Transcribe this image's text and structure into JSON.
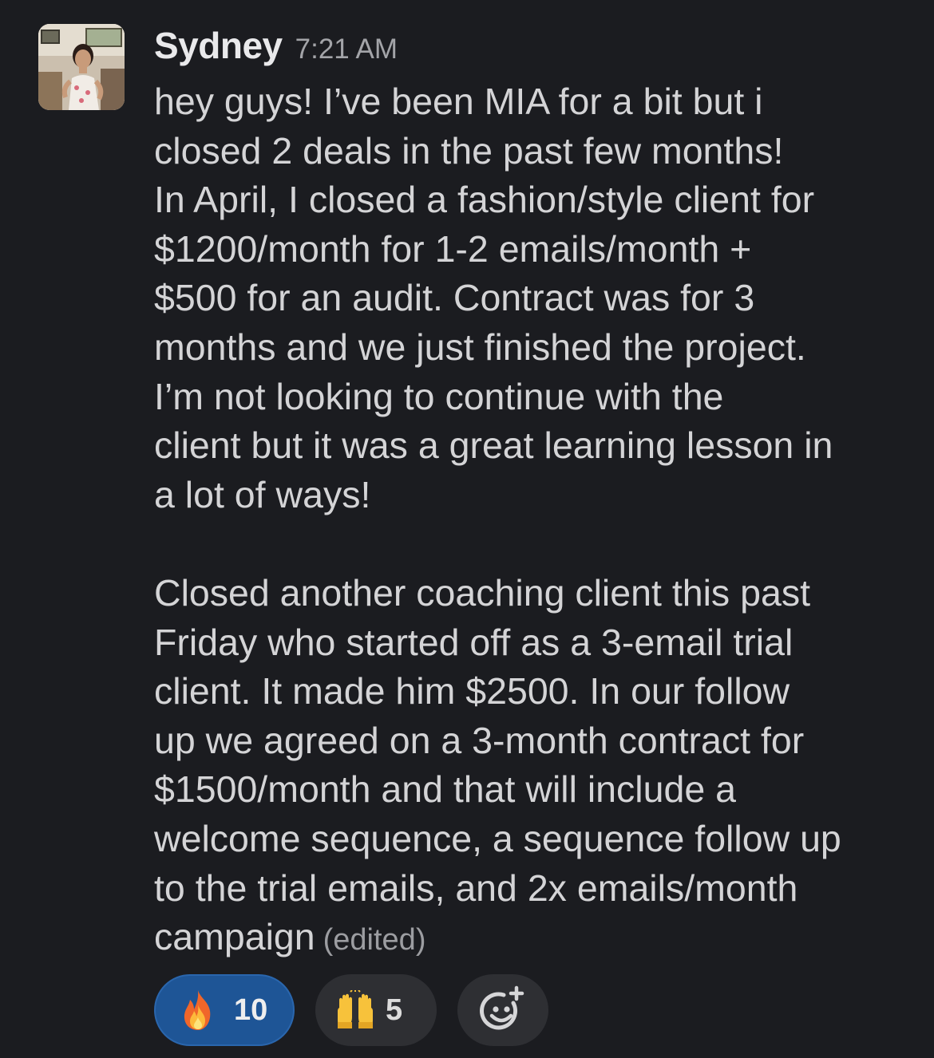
{
  "message": {
    "author": "Sydney",
    "timestamp": "7:21 AM",
    "paragraphs": [
      [
        "hey guys! I’ve been MIA for a bit but i",
        "closed 2 deals in the past few months!",
        "In April, I closed a fashion/style client for",
        "$1200/month for 1-2 emails/month +",
        "$500 for an audit. Contract was for 3",
        "months and we just finished the project.",
        "I’m not looking to continue with the",
        "client but it was a great learning lesson in",
        "a lot of ways!"
      ],
      [
        "Closed another coaching client this past",
        "Friday who started off as a 3-email trial",
        "client. It made him $2500. In our follow",
        "up we agreed on a 3-month contract for",
        "$1500/month and that will include a",
        "welcome sequence, a sequence follow up",
        "to the trial emails, and 2x emails/month",
        "campaign"
      ]
    ],
    "edited_label": "(edited)"
  },
  "reactions": [
    {
      "icon": "fire-emoji-icon",
      "count": "10",
      "selected": true,
      "color": "#1e5596"
    },
    {
      "icon": "raised-hands-emoji-icon",
      "count": "5",
      "selected": false,
      "color": "#2e2f33"
    }
  ],
  "add_reaction": {
    "icon": "add-reaction-icon"
  }
}
